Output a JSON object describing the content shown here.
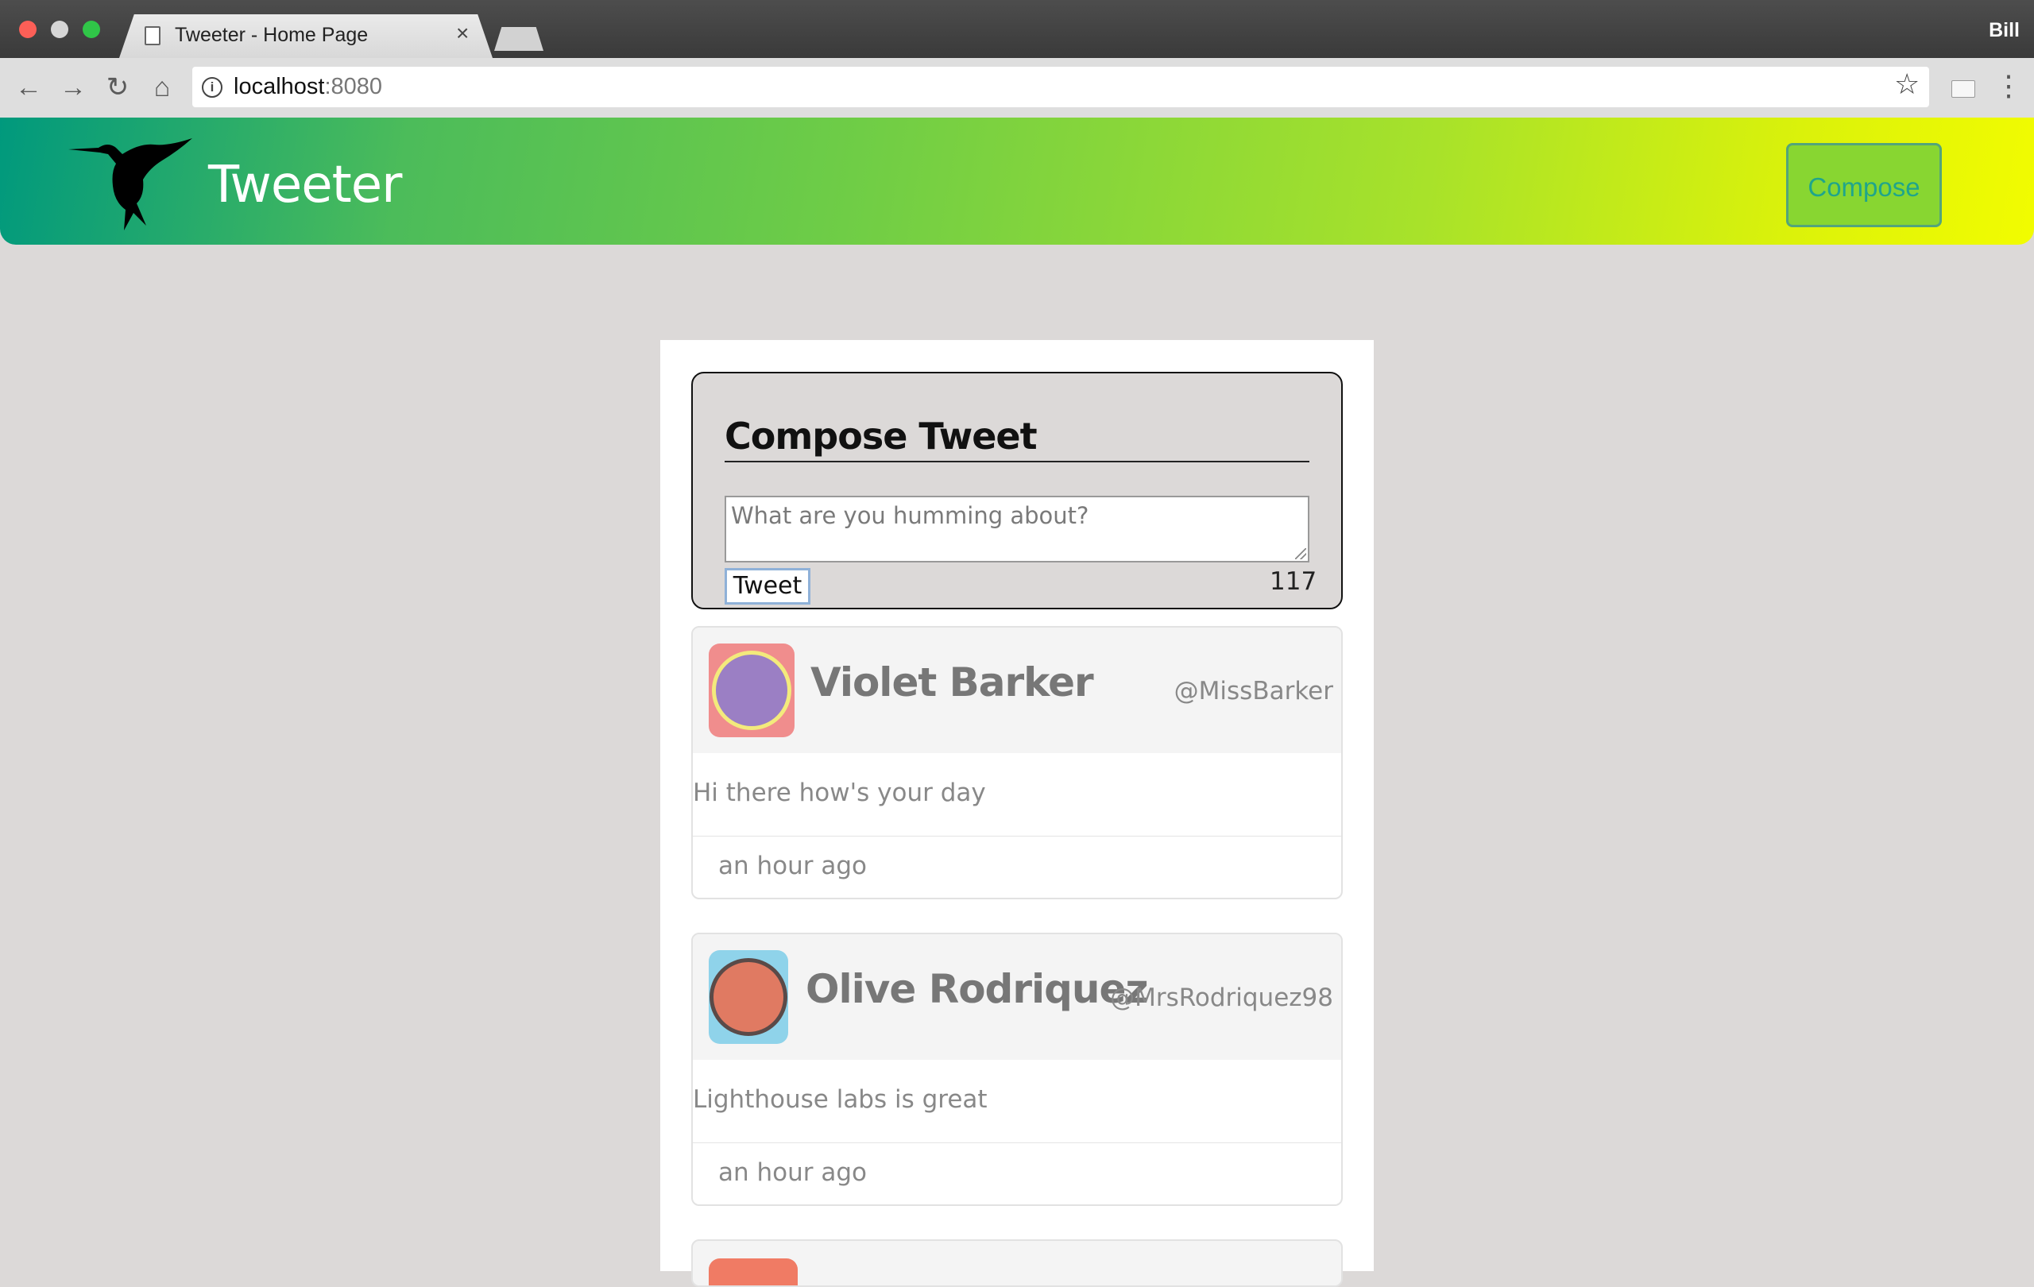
{
  "browser": {
    "tab_title": "Tweeter - Home Page",
    "profile_name": "Bill",
    "url_host": "localhost",
    "url_port": ":8080"
  },
  "header": {
    "title": "Tweeter",
    "compose_label": "Compose",
    "gradient_colors": [
      "#00997d",
      "#6fcd46",
      "#f2fc00"
    ]
  },
  "compose": {
    "heading": "Compose Tweet",
    "placeholder": "What are you humming about?",
    "submit_label": "Tweet",
    "char_count": "117"
  },
  "tweets": [
    {
      "name": "Violet Barker",
      "handle": "@MissBarker",
      "text": "Hi there how's your day",
      "time": "an hour ago",
      "avatar_bg": "#f08d8d",
      "avatar_face": "#9b7fc4"
    },
    {
      "name": "Olive Rodriquez",
      "handle": "@MrsRodriquez98",
      "text": "Lighthouse labs is great",
      "time": "an hour ago",
      "avatar_bg": "#8fd3ea",
      "avatar_face": "#e07a62"
    }
  ]
}
